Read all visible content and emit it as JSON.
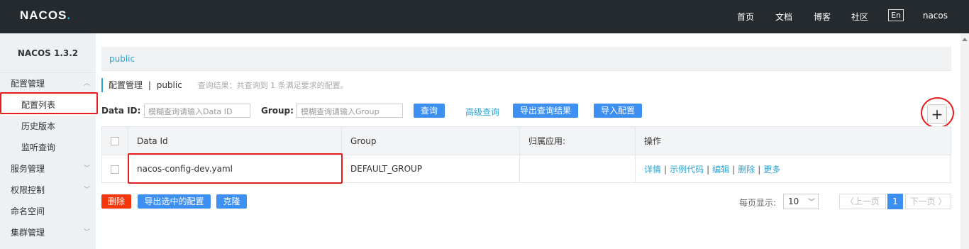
{
  "header": {
    "logo": "NACOS",
    "logo_dot": ".",
    "nav": [
      "首页",
      "文档",
      "博客",
      "社区"
    ],
    "lang": "En",
    "user": "nacos"
  },
  "sidebar": {
    "version": "NACOS 1.3.2",
    "items": [
      {
        "label": "配置管理",
        "sub": false,
        "chevron": true,
        "expanded": true
      },
      {
        "label": "配置列表",
        "sub": true,
        "active": true
      },
      {
        "label": "历史版本",
        "sub": true
      },
      {
        "label": "监听查询",
        "sub": true
      },
      {
        "label": "服务管理",
        "sub": false,
        "chevron": true
      },
      {
        "label": "权限控制",
        "sub": false,
        "chevron": true
      },
      {
        "label": "命名空间",
        "sub": false
      },
      {
        "label": "集群管理",
        "sub": false,
        "chevron": true
      }
    ]
  },
  "namespace_tab": "public",
  "title": {
    "main": "配置管理",
    "sep": "|",
    "ns": "public",
    "summary": "查询结果：共查询到 1 条满足要求的配置。"
  },
  "search": {
    "data_id_label": "Data ID:",
    "data_id_placeholder": "模糊查询请输入Data ID",
    "group_label": "Group:",
    "group_placeholder": "模糊查询请输入Group",
    "query_button": "查询",
    "advanced_link": "高级查询",
    "export_button": "导出查询结果",
    "import_button": "导入配置",
    "add_icon": "+"
  },
  "table": {
    "columns": [
      "Data Id",
      "Group",
      "归属应用:",
      "操作"
    ],
    "rows": [
      {
        "data_id": "nacos-config-dev.yaml",
        "group": "DEFAULT_GROUP",
        "app": "",
        "ops": [
          "详情",
          "示例代码",
          "编辑",
          "删除",
          "更多"
        ]
      }
    ]
  },
  "bulk": {
    "delete": "删除",
    "export_selected": "导出选中的配置",
    "clone": "克隆"
  },
  "pagination": {
    "per_page_label": "每页显示:",
    "per_page_value": "10",
    "prev": "〈上一页",
    "current": "1",
    "next": "下一页 〉"
  },
  "colors": {
    "topbar": "#252a2f",
    "accent": "#3d8ff2",
    "link": "#2aa5d7",
    "danger": "#f4360c",
    "highlight": "#e61e1e"
  }
}
